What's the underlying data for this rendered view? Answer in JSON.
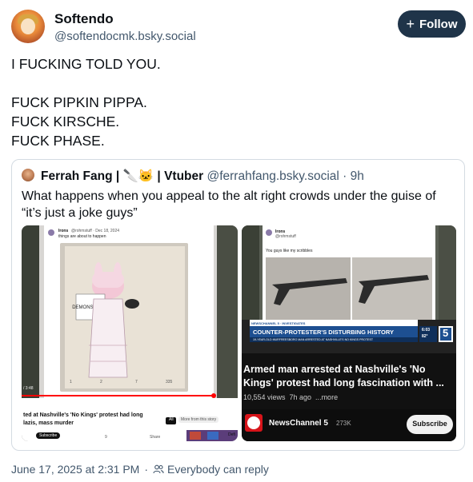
{
  "author": {
    "display_name": "Softendo",
    "handle": "@softendocmk.bsky.social",
    "avatar_icon": "anime-avatar-icon"
  },
  "follow_button": {
    "label": "Follow",
    "icon": "plus-icon"
  },
  "post_lines": [
    "I FUCKING TOLD YOU.",
    "",
    "FUCK PIPKIN PIPPA.",
    "FUCK KIRSCHE.",
    "FUCK PHASE."
  ],
  "quote": {
    "display_name": "Ferrah Fang | 🔪🐱 | Vtuber",
    "handle": "@ferrahfang.bsky.social",
    "age": "· 9h",
    "text_lines": [
      "What happens when you appeal to the alt right crowds under the guise of",
      "“it’s just a joke guys”"
    ],
    "left_image": {
      "post_user": "Irons",
      "post_handle": "@rohmstuff · Dec 18, 2024",
      "post_text": "things are about to happen",
      "video_time": "/ 3:48",
      "caption_line1": "ted at Nashville's 'No Kings' protest had long",
      "caption_line2": "lazis, mass murder",
      "chip_all": "All",
      "chip_more": "More from this story",
      "subscribe": "Subscribe",
      "likes": "9",
      "share": "Share",
      "tab_def": "Defi",
      "stats": [
        "1",
        "2",
        "7",
        "335"
      ]
    },
    "right_image": {
      "post_user": "Irons",
      "post_handle": "@rohmstuff",
      "post_text": "You guys like my scribbles",
      "banner_station": "NEWSCHANNEL 5 · INVESTIGATES",
      "banner_headline": "COUNTER-PROTESTER'S DISTURBING HISTORY",
      "banner_sub": "19-YEAR-OLD MURFREESBORO MAN ARRESTED AT NASHVILLE'S NO KINGS PROTEST",
      "banner_time": "6:03",
      "banner_temp": "82°",
      "channel_badge": "5",
      "title_line1": "Armed man arrested at Nashville's 'No",
      "title_line2": "Kings' protest had long fascination with ...",
      "meta": "10,554 views  7h ago  ...more",
      "channel_name": "NewsChannel 5",
      "subscriber_count": "273K",
      "subscribe": "Subscribe"
    }
  },
  "footer": {
    "timestamp": "June 17, 2025 at 2:31 PM",
    "reply_setting": "Everybody can reply",
    "reply_icon": "people-icon"
  },
  "colors": {
    "text": "#0b0f14",
    "muted": "#42576c",
    "follow_bg": "#1f3449",
    "border": "#d4dbe2",
    "news_red": "#d7141a",
    "news_blue": "#1d4f91"
  }
}
